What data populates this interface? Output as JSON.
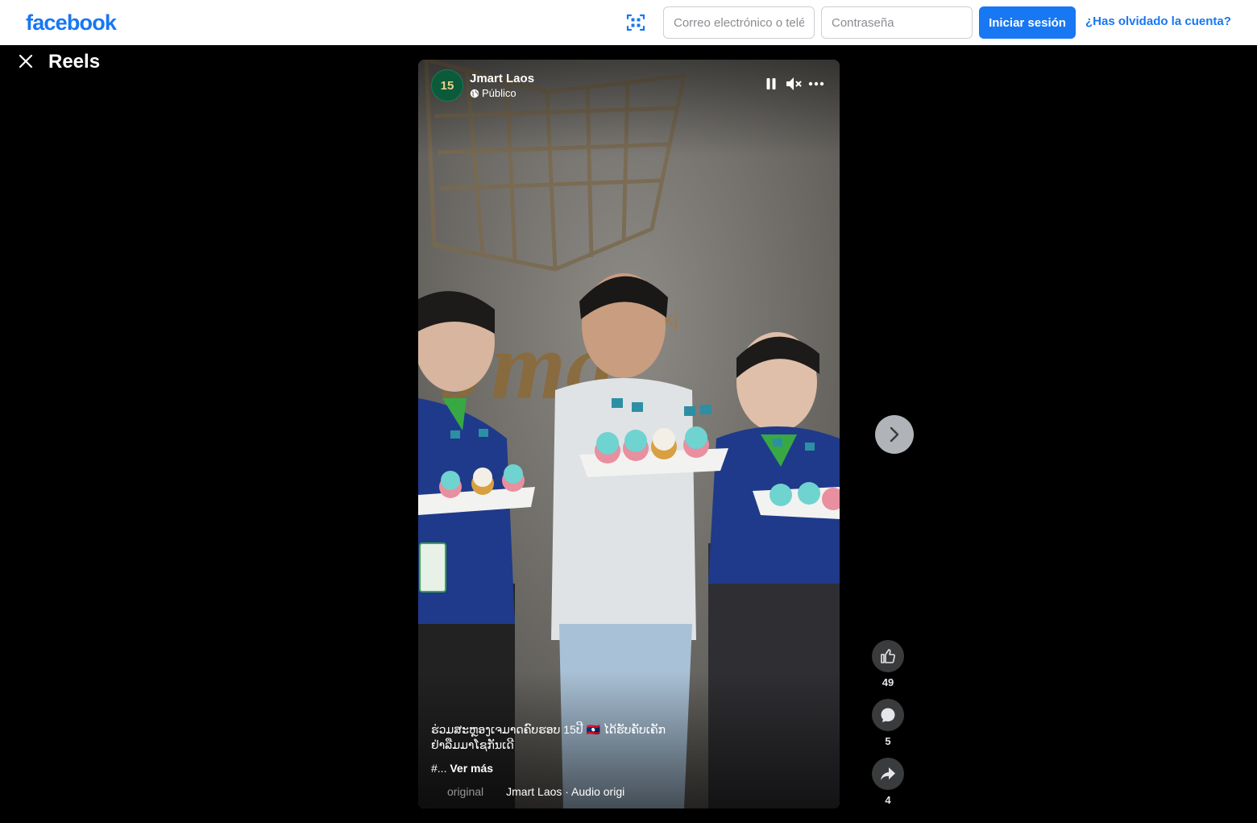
{
  "header": {
    "logo": "facebook",
    "email_placeholder": "Correo electrónico o teléfono",
    "password_placeholder": "Contraseña",
    "login_label": "Iniciar sesión",
    "forgot_label": "¿Has olvidado la cuenta?"
  },
  "reels": {
    "title": "Reels"
  },
  "post": {
    "page_name": "Jmart Laos",
    "avatar_text": "15",
    "privacy": "Público",
    "caption": "ຮ່ວມສະຫຼອງເຈມາດຄົບຮອບ 15ປີ 🇱🇦 ໄດ້ຮັບຄັບເຄັກຢ່າລືມມາໂຊກັນເດີ",
    "tags_prefix": "#...",
    "see_more": "Ver más",
    "audio_dim": "original",
    "audio": "Jmart Laos · Audio original"
  },
  "actions": {
    "likes": "49",
    "comments": "5",
    "shares": "4"
  },
  "icons": {
    "scan": "qr-scan-icon",
    "close": "close-icon",
    "pause": "pause-icon",
    "mute": "muted-speaker-icon",
    "more": "more-horizontal-icon",
    "globe": "globe-icon",
    "audio": "audio-wave-icon",
    "next": "chevron-right-icon",
    "like": "thumbs-up-icon",
    "comment": "comment-bubble-icon",
    "share": "share-arrow-icon"
  },
  "colors": {
    "brand": "#1877f2",
    "page_bg": "#000000",
    "action_bg": "#3a3b3c",
    "next_bg": "#b0b3b8"
  }
}
